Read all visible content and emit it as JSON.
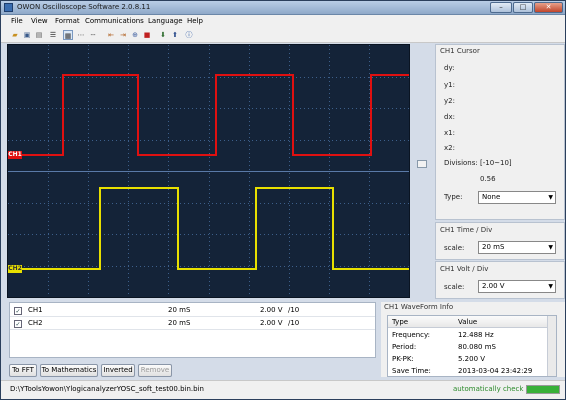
{
  "window": {
    "title": "OWON Oscilloscope Software 2.0.8.11"
  },
  "menu": [
    "File",
    "View",
    "Format",
    "Communications",
    "Language",
    "Help"
  ],
  "channels": {
    "ch1_marker": "CH1",
    "ch2_marker": "CH2"
  },
  "cursor_panel": {
    "title": "CH1 Cursor",
    "dy": "dy:",
    "y1": "y1:",
    "y2": "y2:",
    "dx": "dx:",
    "x1": "x1:",
    "x2": "x2:",
    "divisions_label": "Divisions:",
    "divisions_range": "[-10~10]",
    "divisions_value": "0.56",
    "type_label": "Type:",
    "type_value": "None"
  },
  "time_panel": {
    "title": "CH1 Time / Div",
    "scale_label": "scale:",
    "scale_value": "20 mS"
  },
  "volt_panel": {
    "title": "CH1 Volt / Div",
    "scale_label": "scale:",
    "scale_value": "2.00 V"
  },
  "channel_table": [
    {
      "name": "CH1",
      "time": "20 mS",
      "volt": "2.00 V",
      "div": "/10"
    },
    {
      "name": "CH2",
      "time": "20 mS",
      "volt": "2.00 V",
      "div": "/10"
    }
  ],
  "buttons": {
    "fft": "To FFT",
    "math": "To Mathematics",
    "inverted": "Inverted",
    "remove": "Remove"
  },
  "waveform_info": {
    "title": "CH1 WaveForm Info",
    "col_type": "Type",
    "col_value": "Value",
    "rows": [
      {
        "type": "Frequency:",
        "value": "12.488 Hz"
      },
      {
        "type": "Period:",
        "value": "80.080 mS"
      },
      {
        "type": "PK-PK:",
        "value": "5.200 V"
      },
      {
        "type": "Save Time:",
        "value": "2013-03-04 23:42:29"
      }
    ]
  },
  "status": {
    "path": "D:\\YToolsYowon\\YlogicanalyzerYOSC_soft_test00.bin.bin",
    "usb": "automatically check USB:",
    "progress": 1.0
  },
  "colors": {
    "ch1": "#e01010",
    "ch2": "#e8e000",
    "grid": "#3d5f8a",
    "scope_bg": "#142338"
  }
}
